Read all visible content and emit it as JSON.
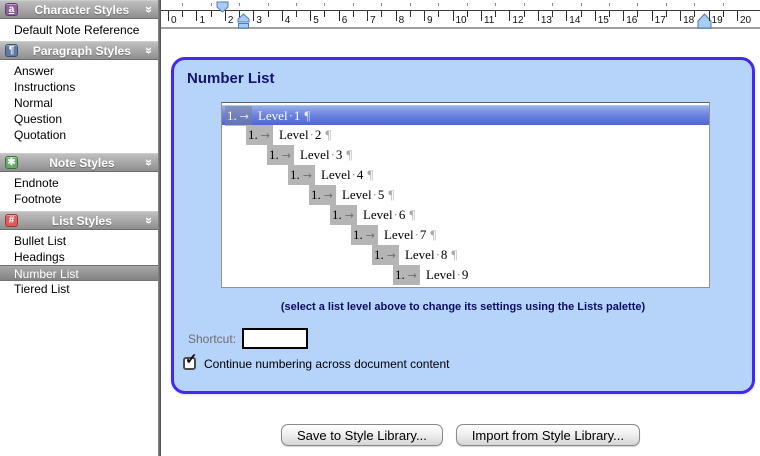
{
  "sidebar": {
    "sections": [
      {
        "id": "character",
        "label": "Character Styles",
        "icon_glyph": "a",
        "icon_color": "#90609a",
        "icon_underlined": true,
        "items": [
          {
            "label": "Default Note Reference"
          }
        ]
      },
      {
        "id": "paragraph",
        "label": "Paragraph Styles",
        "icon_glyph": "¶",
        "icon_color": "#5d7aa8",
        "items": [
          {
            "label": "Answer"
          },
          {
            "label": "Instructions"
          },
          {
            "label": "Normal"
          },
          {
            "label": "Question"
          },
          {
            "label": "Quotation"
          }
        ]
      },
      {
        "id": "note",
        "label": "Note Styles",
        "icon_glyph": "✱",
        "icon_color": "#66ab66",
        "items": [
          {
            "label": "Endnote"
          },
          {
            "label": "Footnote"
          }
        ]
      },
      {
        "id": "list",
        "label": "List Styles",
        "icon_glyph": "#",
        "icon_color": "#e25a5a",
        "items": [
          {
            "label": "Bullet List"
          },
          {
            "label": "Headings"
          },
          {
            "label": "Number List",
            "selected": true
          },
          {
            "label": "Tiered List"
          }
        ]
      }
    ],
    "chevron_glyph": "»"
  },
  "ruler": {
    "numbers": [
      "0",
      "1",
      "2",
      "3",
      "4",
      "5",
      "6",
      "7",
      "8",
      "9",
      "10",
      "11",
      "12",
      "13",
      "14",
      "15",
      "16",
      "17",
      "18",
      "19",
      "20"
    ],
    "markers": {
      "first_line_indent": "2",
      "left_indent": "2.6",
      "right_indent": "18.8"
    }
  },
  "panel": {
    "title": "Number List",
    "levels": [
      {
        "marker": "1.",
        "label": "Level 1",
        "selected": true,
        "pilcrow": true
      },
      {
        "marker": "1.",
        "label": "Level 2",
        "selected": false,
        "pilcrow": true
      },
      {
        "marker": "1.",
        "label": "Level 3",
        "selected": false,
        "pilcrow": true
      },
      {
        "marker": "1.",
        "label": "Level 4",
        "selected": false,
        "pilcrow": true
      },
      {
        "marker": "1.",
        "label": "Level 5",
        "selected": false,
        "pilcrow": true
      },
      {
        "marker": "1.",
        "label": "Level 6",
        "selected": false,
        "pilcrow": true
      },
      {
        "marker": "1.",
        "label": "Level 7",
        "selected": false,
        "pilcrow": true
      },
      {
        "marker": "1.",
        "label": "Level 8",
        "selected": false,
        "pilcrow": true
      },
      {
        "marker": "1.",
        "label": "Level 9",
        "selected": false,
        "pilcrow": false
      }
    ],
    "glyphs": {
      "tab": "→",
      "pilcrow": "¶",
      "space_dot": "·",
      "check": "✓"
    },
    "hint": "(select a list level above to change its settings using the Lists palette)",
    "shortcut_label": "Shortcut:",
    "shortcut_value": "",
    "checkbox_label": "Continue numbering across document content",
    "checkbox_checked": true
  },
  "footer": {
    "save_label": "Save to Style Library...",
    "import_label": "Import from Style Library..."
  },
  "colors": {
    "panel_border": "#4129ef",
    "panel_bg": "#b6d3fa",
    "selection_top": "#97afe9",
    "selection_bottom": "#4b66d3",
    "header_gray": "#9a9a9a"
  }
}
